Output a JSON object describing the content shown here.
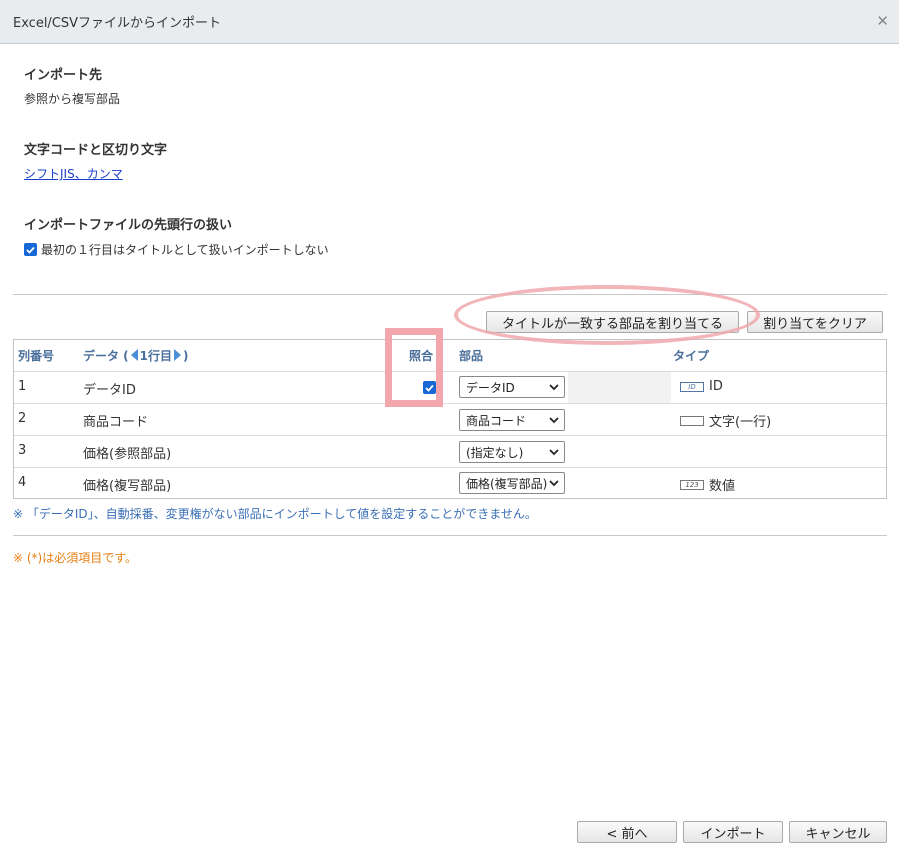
{
  "dialog": {
    "title": "Excel/CSVファイルからインポート",
    "close_icon": "close-icon"
  },
  "sections": {
    "target": {
      "heading": "インポート先",
      "value": "参照から複写部品"
    },
    "encoding": {
      "heading": "文字コードと区切り文字",
      "link": "シフトJIS、カンマ"
    },
    "first_row": {
      "heading": "インポートファイルの先頭行の扱い",
      "checkbox_label": "最初の１行目はタイトルとして扱いインポートしない",
      "checked": true
    }
  },
  "toolbar": {
    "assign_title_button": "タイトルが一致する部品を割り当てる",
    "clear_button": "割り当てをクリア"
  },
  "table": {
    "headers": {
      "col_no": "列番号",
      "data_prefix": "データ (",
      "data_row": "1行目",
      "data_suffix": ")",
      "match": "照合",
      "part": "部品",
      "type": "タイプ"
    },
    "rows": [
      {
        "no": "1",
        "data": "データID",
        "match": true,
        "part": "データID",
        "type_icon": "ID",
        "type": "ID"
      },
      {
        "no": "2",
        "data": "商品コード",
        "match": false,
        "part": "商品コード",
        "type_icon": "",
        "type": "文字(一行)"
      },
      {
        "no": "3",
        "data": "価格(参照部品)",
        "match": false,
        "part": "(指定なし)",
        "type_icon": "",
        "type": ""
      },
      {
        "no": "4",
        "data": "価格(複写部品)",
        "match": false,
        "part": "価格(複写部品)",
        "type_icon": "123",
        "type": "数値"
      }
    ]
  },
  "notes": {
    "warning": "※ 「データID」、自動採番、変更権がない部品にインポートして値を設定することができません。",
    "required": "※ (*)は必須項目です。"
  },
  "footer": {
    "back_button": "< 前へ",
    "import_button": "インポート",
    "cancel_button": "キャンセル"
  },
  "colors": {
    "accent": "#1668d6",
    "header_text": "#4b6f9b",
    "note_text": "#3a6fb5",
    "required_text": "#e67f12",
    "highlight": "#f3a7ad"
  }
}
